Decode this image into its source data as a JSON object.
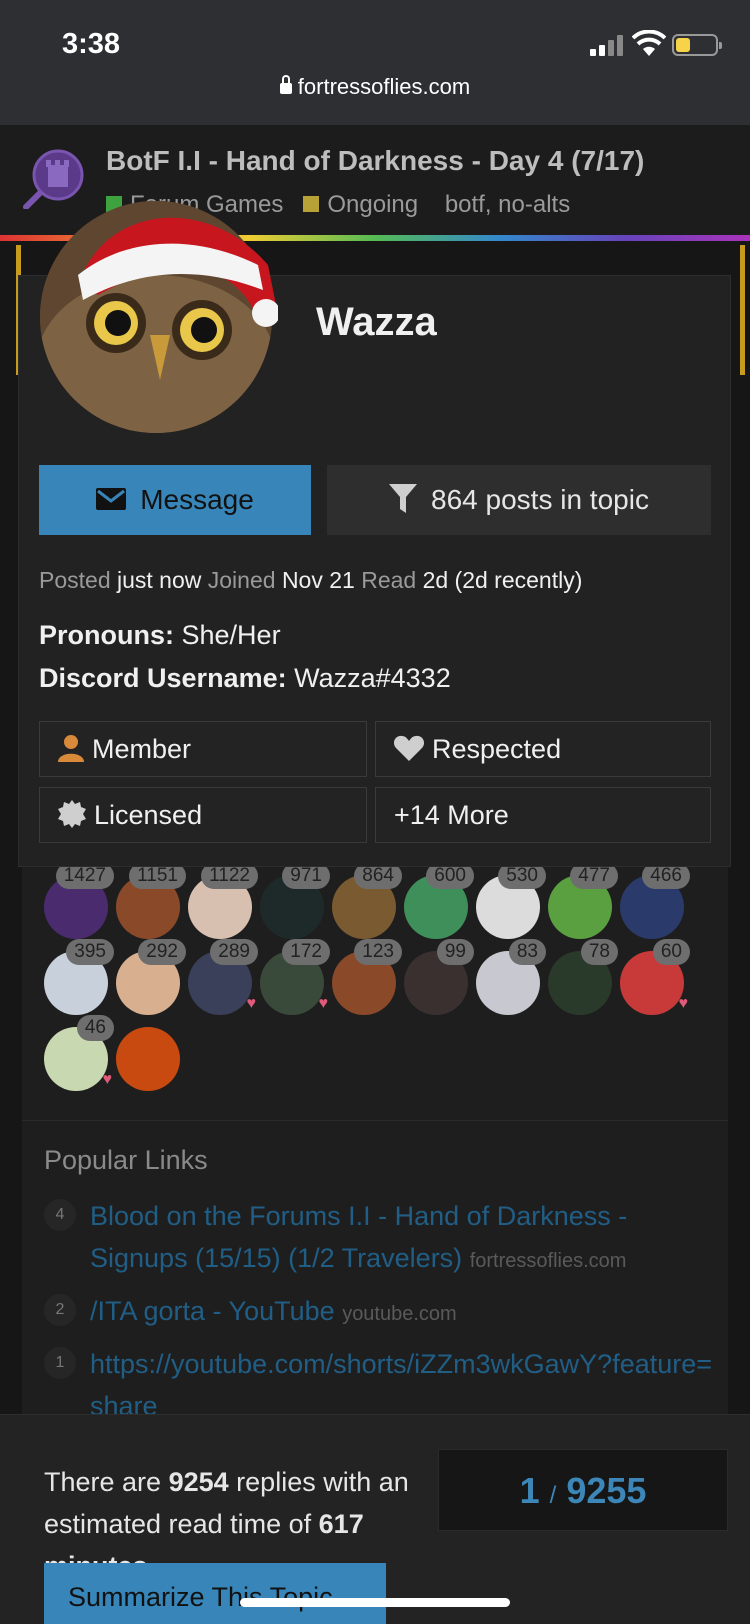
{
  "status": {
    "time": "3:38",
    "url": "fortressoflies.com"
  },
  "topic": {
    "title": "BotF I.I - Hand of Darkness - Day 4 (7/17)",
    "category": "Forum Games",
    "status_tag": "Ongoing",
    "tags": "botf, no-alts",
    "category_color": "#3ea33e",
    "status_color": "#b7a237"
  },
  "usercard": {
    "username": "Wazza",
    "message_label": "Message",
    "posts_label": "864 posts in topic",
    "posted_label": "Posted",
    "posted_value": "just now",
    "joined_label": "Joined",
    "joined_value": "Nov 21",
    "read_label": "Read",
    "read_value": "2d (2d recently)",
    "pronouns_label": "Pronouns:",
    "pronouns_value": "She/Her",
    "discord_label": "Discord Username:",
    "discord_value": "Wazza#4332",
    "badges": [
      {
        "label": "Member",
        "icon": "user-icon",
        "color": "#d9893a"
      },
      {
        "label": "Respected",
        "icon": "heart-icon",
        "color": "#cfcfcf"
      },
      {
        "label": "Licensed",
        "icon": "certificate-icon",
        "color": "#cfcfcf"
      },
      {
        "label": "+14 More"
      }
    ]
  },
  "participants": [
    {
      "count": "1427",
      "color": "#4a2b6e"
    },
    {
      "count": "1151",
      "color": "#8a4a2a"
    },
    {
      "count": "1122",
      "color": "#d8c0b0"
    },
    {
      "count": "971",
      "color": "#1e2a2a"
    },
    {
      "count": "864",
      "color": "#7a5a30"
    },
    {
      "count": "600",
      "color": "#3f8f5a"
    },
    {
      "count": "530",
      "color": "#dcdcdc"
    },
    {
      "count": "477",
      "color": "#5aa040"
    },
    {
      "count": "466",
      "color": "#2a3a6a"
    },
    {
      "count": "395",
      "color": "#c8d0dc"
    },
    {
      "count": "292",
      "color": "#d8b090"
    },
    {
      "count": "289",
      "color": "#3a3f5a",
      "heart": true
    },
    {
      "count": "172",
      "color": "#3a4a3a",
      "heart": true
    },
    {
      "count": "123",
      "color": "#8a4a2a"
    },
    {
      "count": "99",
      "color": "#3a3030"
    },
    {
      "count": "83",
      "color": "#c8c8d0"
    },
    {
      "count": "78",
      "color": "#2a3a2a"
    },
    {
      "count": "60",
      "color": "#c83a3a",
      "heart": true
    },
    {
      "count": "46",
      "color": "#c8d8b0",
      "heart": true
    },
    {
      "count": "",
      "color": "#c84a10"
    }
  ],
  "popular": {
    "title": "Popular Links",
    "links": [
      {
        "count": "4",
        "text": "Blood on the Forums I.I - Hand of Darkness - Signups (15/15) (1/2 Travelers)",
        "domain": "fortressoflies.com"
      },
      {
        "count": "2",
        "text": "/ITA gorta - YouTube",
        "domain": "youtube.com"
      },
      {
        "count": "1",
        "text": "https://youtube.com/shorts/iZZm3wkGawY?feature=share",
        "domain": ""
      }
    ]
  },
  "footer": {
    "replies_pre": "There are",
    "replies_count": "9254",
    "replies_mid": "replies with an estimated read time of",
    "minutes": "617 minutes",
    "replies_end": ".",
    "progress_current": "1",
    "progress_sep": "/",
    "progress_total": "9255",
    "summarize_label": "Summarize This Topic"
  }
}
